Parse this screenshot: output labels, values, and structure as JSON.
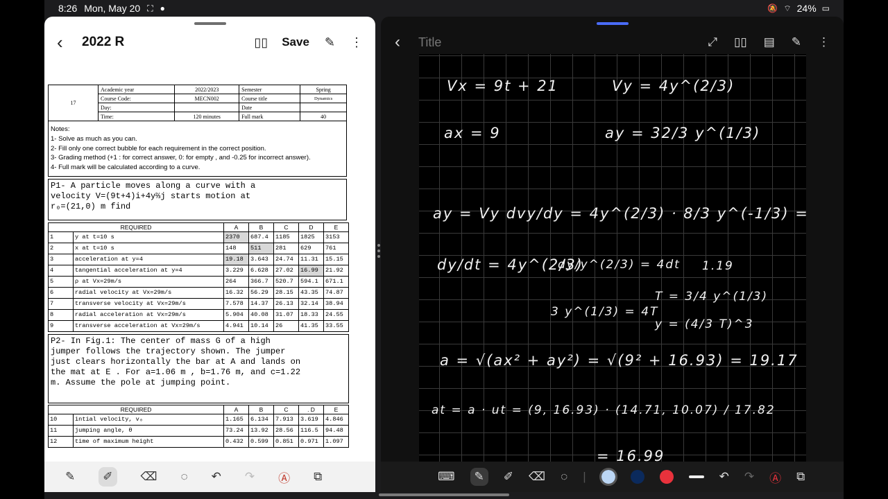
{
  "status": {
    "time": "8:26",
    "date": "Mon, May 20",
    "battery": "24%"
  },
  "left_pane": {
    "title": "2022 R",
    "save_label": "Save",
    "header_table": {
      "code_num": "17",
      "rows": [
        [
          "Academic year",
          "2022/2023",
          "Semester",
          "Spring"
        ],
        [
          "Course Code:",
          "MECN002",
          "Course title",
          "Dynamics"
        ],
        [
          "Day:",
          "",
          "Date",
          ""
        ],
        [
          "Time:",
          "120 minutes",
          "Full mark",
          "40"
        ]
      ]
    },
    "notes": [
      "Notes:",
      "1- Solve as much as you can.",
      "2- Fill only one correct bubble for each requirement in the correct position.",
      "3- Grading method (+1 : for correct answer, 0: for empty , and -0.25 for incorrect answer).",
      "4- Full mark will be calculated according to a curve."
    ],
    "p1": [
      "P1- A particle moves along a curve with a",
      "velocity   V=(9t+4)i+4y⅔j starts motion at",
      "r₀=(21,0) m find"
    ],
    "table1_header": [
      "REQUIRED",
      "A",
      "B",
      "C",
      "D",
      "E"
    ],
    "table1": [
      [
        "1",
        "y at t=10 s",
        "2370",
        "687.4",
        "1185",
        "1825",
        "3153"
      ],
      [
        "2",
        "x at t=10 s",
        "148",
        "511",
        "281",
        "629",
        "761"
      ],
      [
        "3",
        "acceleration at y=4",
        "19.18",
        "3.643",
        "24.74",
        "11.31",
        "15.15"
      ],
      [
        "4",
        "tangential acceleration at y=4",
        "3.229",
        "6.628",
        "27.02",
        "16.99",
        "21.92"
      ],
      [
        "5",
        "ρ at Vx=29m/s",
        "264",
        "366.7",
        "520.7",
        "594.1",
        "671.1"
      ],
      [
        "6",
        "radial velocity  at Vx=29m/s",
        "16.32",
        "56.29",
        "28.15",
        "43.35",
        "74.87"
      ],
      [
        "7",
        "transverse velocity  at Vx=29m/s",
        "7.578",
        "14.37",
        "26.13",
        "32.14",
        "38.94"
      ],
      [
        "8",
        "radial acceleration at Vx=29m/s",
        "5.904",
        "40.08",
        "31.07",
        "18.33",
        "24.55"
      ],
      [
        "9",
        "transverse acceleration at Vx=29m/s",
        "4.941",
        "10.14",
        "26",
        "41.35",
        "33.55"
      ]
    ],
    "p2": [
      "P2- In Fig.1:  The center of mass G of a high",
      "jumper follows the trajectory shown. The jumper",
      "just clears horizontally the bar at A and lands on",
      "the mat at E . For a=1.06 m , b=1.76 m, and c=1.22",
      "m. Assume the pole at jumping point."
    ],
    "table2_header": [
      "REQUIRED",
      "A",
      "B",
      "C",
      ". D",
      "E"
    ],
    "table2": [
      [
        "10",
        "intial velocity, v₀",
        "1.165",
        "6.134",
        "7.913",
        "3.619",
        "4.846"
      ],
      [
        "11",
        "jumping angle, θ",
        "73.24",
        "13.92",
        "28.56",
        "116.5",
        "94.48"
      ],
      [
        "12",
        "time of maximum height",
        "0.432",
        "0.599",
        "0.851",
        "0.971",
        "1.097"
      ]
    ]
  },
  "right_pane": {
    "title": "Title",
    "handwriting": {
      "vx": "Vx = 9t + 21",
      "vy": "Vy = 4y^(2/3)",
      "ax": "ax = 9",
      "ay": "ay = 32/3 y^(1/3)",
      "ay_chain": "ay = Vy dvy/dy = 4y^(2/3) · 8/3 y^(-1/3) =",
      "dy_dt": "dy/dt = 4y^(2/3)",
      "sep": "dy/y^(2/3) = 4dt",
      "val_119": "1.19",
      "integ": "3 y^(1/3) = 4T",
      "T_expr": "T = 3/4 y^(1/3)",
      "y_expr": "y = (4/3 T)^3",
      "a_mag": "a = √(ax² + ay²) = √(9² + 16.93) = 19.17",
      "at": "at = a · ut = (9, 16.93) · (14.71, 10.07) / 17.82",
      "at_val": "= 16.99"
    },
    "colors": {
      "light_blue": "#bcd7f5",
      "navy": "#0b2a5c",
      "red": "#e8323c"
    }
  }
}
